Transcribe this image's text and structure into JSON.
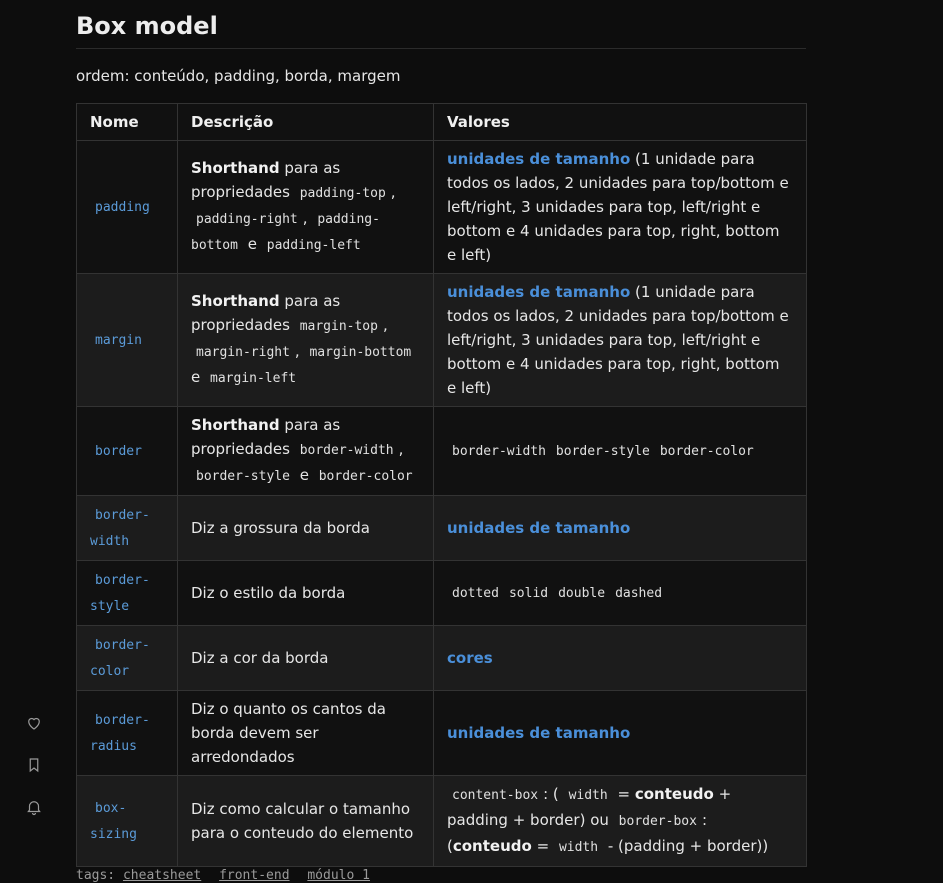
{
  "title": "Box model",
  "intro": "ordem: conteúdo, padding, borda, margem",
  "headers": {
    "nome": "Nome",
    "descricao": "Descrição",
    "valores": "Valores"
  },
  "common": {
    "shorthand": "Shorthand",
    "para_as": "para as",
    "propriedades": "propriedades",
    "e": "e",
    "comma": ",",
    "unidades": "unidades de tamanho",
    "unidades_desc": "(1 unidade para todos os lados, 2 unidades para top/bottom e left/right, 3 unidades para top, left/right e bottom e 4 unidades para top, right, bottom e left)",
    "cores": "cores"
  },
  "rows": {
    "padding": {
      "name": "padding",
      "p1": "padding-top",
      "p2": "padding-right",
      "p3": "padding-bottom",
      "p4": "padding-left"
    },
    "margin": {
      "name": "margin",
      "p1": "margin-top",
      "p2": "margin-right",
      "p3": "margin-bottom",
      "p4": "margin-left"
    },
    "border": {
      "name": "border",
      "p1": "border-width",
      "p2": "border-style",
      "p3": "border-color"
    },
    "border_width": {
      "name": "border-width",
      "desc": "Diz a grossura da borda"
    },
    "border_style": {
      "name": "border-style",
      "desc": "Diz o estilo da borda",
      "values": [
        "dotted",
        "solid",
        "double",
        "dashed"
      ]
    },
    "border_color": {
      "name": "border-color",
      "desc": "Diz a cor da borda"
    },
    "border_radius": {
      "name": "border-radius",
      "desc": "Diz o quanto os cantos da borda devem ser arredondados"
    },
    "box_sizing": {
      "name": "box-sizing",
      "desc": "Diz como calcular o tamanho para o conteudo do elemento",
      "v1": "content-box",
      "colon_open": ": (",
      "width": "width",
      "eq": "=",
      "conteudo": "conteudo",
      "plus_pb": "+ padding + border) ou",
      "v2": "border-box",
      "colon_paren": ": (",
      "minus_pb": "- (padding + border))"
    }
  },
  "tags": {
    "label": "tags:",
    "items": [
      "cheatsheet",
      "front-end",
      "módulo 1"
    ]
  },
  "icons": [
    "heart-icon",
    "bookmark-icon",
    "bell-icon"
  ],
  "colors": {
    "link": "#4a8fd9",
    "code_name": "#5b9bd8",
    "background": "#0d0d0d"
  }
}
